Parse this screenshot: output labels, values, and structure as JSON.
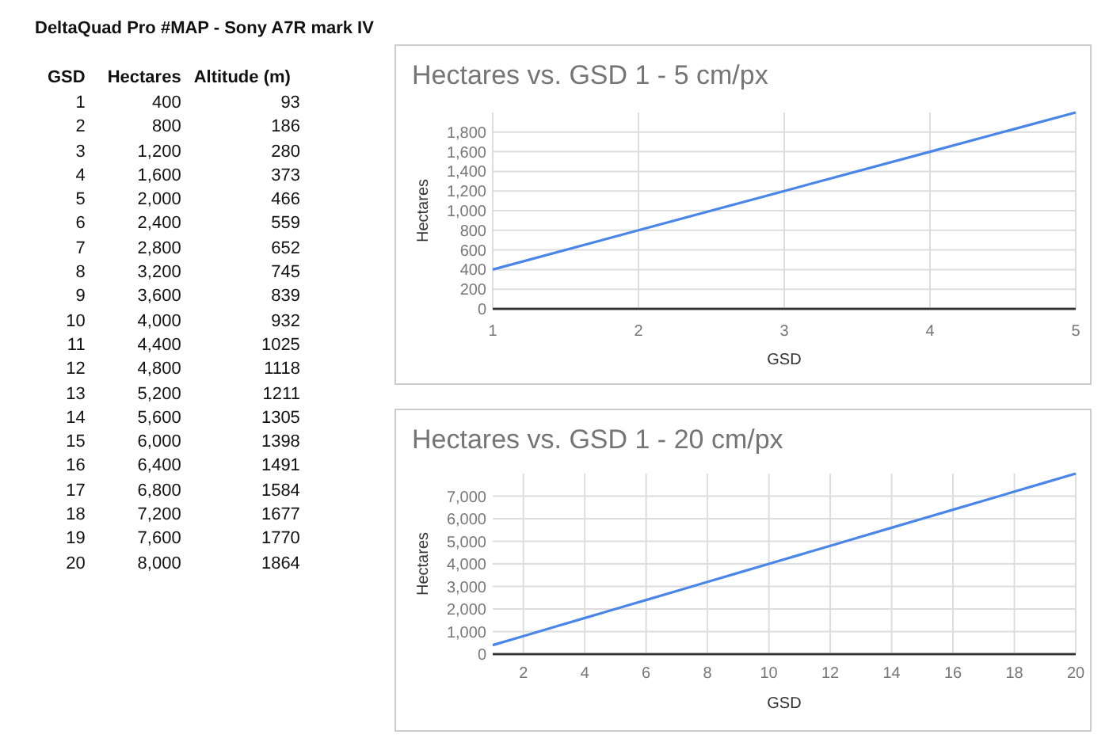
{
  "title": "DeltaQuad Pro #MAP - Sony A7R mark IV",
  "table": {
    "columns": [
      "GSD",
      "Hectares",
      "Altitude (m)"
    ],
    "rows": [
      [
        "1",
        "400",
        "93"
      ],
      [
        "2",
        "800",
        "186"
      ],
      [
        "3",
        "1,200",
        "280"
      ],
      [
        "4",
        "1,600",
        "373"
      ],
      [
        "5",
        "2,000",
        "466"
      ],
      [
        "6",
        "2,400",
        "559"
      ],
      [
        "7",
        "2,800",
        "652"
      ],
      [
        "8",
        "3,200",
        "745"
      ],
      [
        "9",
        "3,600",
        "839"
      ],
      [
        "10",
        "4,000",
        "932"
      ],
      [
        "11",
        "4,400",
        "1025"
      ],
      [
        "12",
        "4,800",
        "1118"
      ],
      [
        "13",
        "5,200",
        "1211"
      ],
      [
        "14",
        "5,600",
        "1305"
      ],
      [
        "15",
        "6,000",
        "1398"
      ],
      [
        "16",
        "6,400",
        "1491"
      ],
      [
        "17",
        "6,800",
        "1584"
      ],
      [
        "18",
        "7,200",
        "1677"
      ],
      [
        "19",
        "7,600",
        "1770"
      ],
      [
        "20",
        "8,000",
        "1864"
      ]
    ]
  },
  "charts": [
    {
      "chart_data": {
        "type": "line",
        "title": "Hectares vs. GSD 1 - 5 cm/px",
        "xlabel": "GSD",
        "ylabel": "Hectares",
        "x": [
          1,
          2,
          3,
          4,
          5
        ],
        "grid": true,
        "series": [
          {
            "color": "#4a86e8",
            "values": [
              400,
              800,
              1200,
              1600,
              2000
            ]
          }
        ],
        "xlim": [
          1,
          5
        ],
        "ylim": [
          0,
          2000
        ],
        "xticks": [
          1,
          2,
          3,
          4,
          5
        ],
        "yticks": [
          {
            "value": 0,
            "label": "0"
          },
          {
            "value": 200,
            "label": "200"
          },
          {
            "value": 400,
            "label": "400"
          },
          {
            "value": 600,
            "label": "600"
          },
          {
            "value": 800,
            "label": "800"
          },
          {
            "value": 1000,
            "label": "1,000"
          },
          {
            "value": 1200,
            "label": "1,200"
          },
          {
            "value": 1400,
            "label": "1,400"
          },
          {
            "value": 1600,
            "label": "1,600"
          },
          {
            "value": 1800,
            "label": "1,800"
          }
        ]
      }
    },
    {
      "chart_data": {
        "type": "line",
        "title": "Hectares vs. GSD 1 - 20 cm/px",
        "xlabel": "GSD",
        "ylabel": "Hectares",
        "x": [
          1,
          2,
          3,
          4,
          5,
          6,
          7,
          8,
          9,
          10,
          11,
          12,
          13,
          14,
          15,
          16,
          17,
          18,
          19,
          20
        ],
        "grid": true,
        "series": [
          {
            "color": "#4a86e8",
            "values": [
              400,
              800,
              1200,
              1600,
              2000,
              2400,
              2800,
              3200,
              3600,
              4000,
              4400,
              4800,
              5200,
              5600,
              6000,
              6400,
              6800,
              7200,
              7600,
              8000
            ]
          }
        ],
        "xlim": [
          1,
          20
        ],
        "ylim": [
          0,
          8000
        ],
        "xticks": [
          2,
          4,
          6,
          8,
          10,
          12,
          14,
          16,
          18,
          20
        ],
        "yticks": [
          {
            "value": 0,
            "label": "0"
          },
          {
            "value": 1000,
            "label": "1,000"
          },
          {
            "value": 2000,
            "label": "2,000"
          },
          {
            "value": 3000,
            "label": "3,000"
          },
          {
            "value": 4000,
            "label": "4,000"
          },
          {
            "value": 5000,
            "label": "5,000"
          },
          {
            "value": 6000,
            "label": "6,000"
          },
          {
            "value": 7000,
            "label": "7,000"
          }
        ]
      }
    }
  ]
}
